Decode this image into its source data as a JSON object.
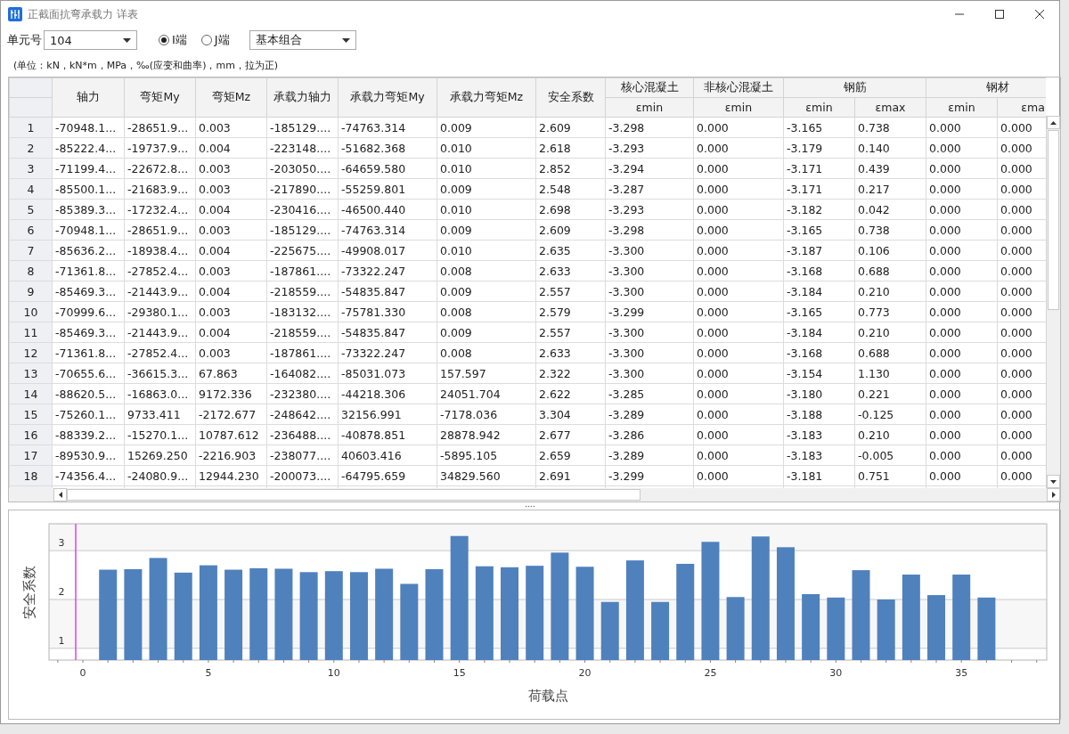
{
  "window": {
    "title": "正截面抗弯承载力 详表"
  },
  "toolbar": {
    "unit_label": "单元号",
    "unit_value": "104",
    "end_options": [
      {
        "label": "I端",
        "selected": true
      },
      {
        "label": "J端",
        "selected": false
      }
    ],
    "combo_value": "基本组合"
  },
  "note": "(单位：kN，kN*m，MPa，‰(应变和曲率)，mm，拉为正)",
  "table": {
    "columns": [
      {
        "label": "轴力"
      },
      {
        "label": "弯矩My"
      },
      {
        "label": "弯矩Mz"
      },
      {
        "label": "承载力轴力"
      },
      {
        "label": "承载力弯矩My"
      },
      {
        "label": "承载力弯矩Mz"
      },
      {
        "label": "安全系数"
      },
      {
        "label": "核心混凝土",
        "sub": [
          "εmin"
        ]
      },
      {
        "label": "非核心混凝土",
        "sub": [
          "εmin"
        ]
      },
      {
        "label": "钢筋",
        "colspan": 2,
        "sub": [
          "εmin",
          "εmax"
        ]
      },
      {
        "label": "钢材",
        "colspan": 2,
        "sub": [
          "εmin",
          "εma"
        ]
      }
    ],
    "rows": [
      {
        "index": "1",
        "cells": [
          "-70948.1...",
          "-28651.9...",
          "0.003",
          "-185129....",
          "-74763.314",
          "0.009",
          "2.609",
          "-3.298",
          "0.000",
          "-3.165",
          "0.738",
          "0.000",
          "0.000"
        ]
      },
      {
        "index": "2",
        "cells": [
          "-85222.4...",
          "-19737.9...",
          "0.004",
          "-223148....",
          "-51682.368",
          "0.010",
          "2.618",
          "-3.293",
          "0.000",
          "-3.179",
          "0.140",
          "0.000",
          "0.000"
        ]
      },
      {
        "index": "3",
        "cells": [
          "-71199.4...",
          "-22672.8...",
          "0.003",
          "-203050....",
          "-64659.580",
          "0.010",
          "2.852",
          "-3.294",
          "0.000",
          "-3.171",
          "0.439",
          "0.000",
          "0.000"
        ]
      },
      {
        "index": "4",
        "cells": [
          "-85500.1...",
          "-21683.9...",
          "0.003",
          "-217890....",
          "-55259.801",
          "0.009",
          "2.548",
          "-3.287",
          "0.000",
          "-3.171",
          "0.217",
          "0.000",
          "0.000"
        ]
      },
      {
        "index": "5",
        "cells": [
          "-85389.3...",
          "-17232.4...",
          "0.004",
          "-230416....",
          "-46500.440",
          "0.010",
          "2.698",
          "-3.293",
          "0.000",
          "-3.182",
          "0.042",
          "0.000",
          "0.000"
        ]
      },
      {
        "index": "6",
        "cells": [
          "-70948.1...",
          "-28651.9...",
          "0.003",
          "-185129....",
          "-74763.314",
          "0.009",
          "2.609",
          "-3.298",
          "0.000",
          "-3.165",
          "0.738",
          "0.000",
          "0.000"
        ]
      },
      {
        "index": "7",
        "cells": [
          "-85636.2...",
          "-18938.4...",
          "0.004",
          "-225675....",
          "-49908.017",
          "0.010",
          "2.635",
          "-3.300",
          "0.000",
          "-3.187",
          "0.106",
          "0.000",
          "0.000"
        ]
      },
      {
        "index": "8",
        "cells": [
          "-71361.8...",
          "-27852.4...",
          "0.003",
          "-187861....",
          "-73322.247",
          "0.008",
          "2.633",
          "-3.300",
          "0.000",
          "-3.168",
          "0.688",
          "0.000",
          "0.000"
        ]
      },
      {
        "index": "9",
        "cells": [
          "-85469.3...",
          "-21443.9...",
          "0.004",
          "-218559....",
          "-54835.847",
          "0.009",
          "2.557",
          "-3.300",
          "0.000",
          "-3.184",
          "0.210",
          "0.000",
          "0.000"
        ]
      },
      {
        "index": "10",
        "cells": [
          "-70999.6...",
          "-29380.1...",
          "0.003",
          "-183132....",
          "-75781.330",
          "0.008",
          "2.579",
          "-3.299",
          "0.000",
          "-3.165",
          "0.773",
          "0.000",
          "0.000"
        ]
      },
      {
        "index": "11",
        "cells": [
          "-85469.3...",
          "-21443.9...",
          "0.004",
          "-218559....",
          "-54835.847",
          "0.009",
          "2.557",
          "-3.300",
          "0.000",
          "-3.184",
          "0.210",
          "0.000",
          "0.000"
        ]
      },
      {
        "index": "12",
        "cells": [
          "-71361.8...",
          "-27852.4...",
          "0.003",
          "-187861....",
          "-73322.247",
          "0.008",
          "2.633",
          "-3.300",
          "0.000",
          "-3.168",
          "0.688",
          "0.000",
          "0.000"
        ]
      },
      {
        "index": "13",
        "cells": [
          "-70655.6...",
          "-36615.3...",
          "67.863",
          "-164082....",
          "-85031.073",
          "157.597",
          "2.322",
          "-3.300",
          "0.000",
          "-3.154",
          "1.130",
          "0.000",
          "0.000"
        ]
      },
      {
        "index": "14",
        "cells": [
          "-88620.5...",
          "-16863.0...",
          "9172.336",
          "-232380....",
          "-44218.306",
          "24051.704",
          "2.622",
          "-3.285",
          "0.000",
          "-3.180",
          "0.221",
          "0.000",
          "0.000"
        ]
      },
      {
        "index": "15",
        "cells": [
          "-75260.1...",
          "9733.411",
          "-2172.677",
          "-248642....",
          "32156.991",
          "-7178.036",
          "3.304",
          "-3.289",
          "0.000",
          "-3.188",
          "-0.125",
          "0.000",
          "0.000"
        ]
      },
      {
        "index": "16",
        "cells": [
          "-88339.2...",
          "-15270.1...",
          "10787.612",
          "-236488....",
          "-40878.851",
          "28878.942",
          "2.677",
          "-3.286",
          "0.000",
          "-3.183",
          "0.210",
          "0.000",
          "0.000"
        ]
      },
      {
        "index": "17",
        "cells": [
          "-89530.9...",
          "15269.250",
          "-2216.903",
          "-238077....",
          "40603.416",
          "-5895.105",
          "2.659",
          "-3.289",
          "0.000",
          "-3.183",
          "-0.005",
          "0.000",
          "0.000"
        ]
      },
      {
        "index": "18",
        "cells": [
          "-74356.4...",
          "-24080.9...",
          "12944.230",
          "-200073....",
          "-64795.659",
          "34829.560",
          "2.691",
          "-3.299",
          "0.000",
          "-3.181",
          "0.751",
          "0.000",
          "0.000"
        ]
      }
    ]
  },
  "chart": {
    "chart_data": {
      "type": "bar",
      "xlabel": "荷载点",
      "ylabel": "安全系数",
      "x": [
        1,
        2,
        3,
        4,
        5,
        6,
        7,
        8,
        9,
        10,
        11,
        12,
        13,
        14,
        15,
        16,
        17,
        18,
        19,
        20,
        21,
        22,
        23,
        24,
        25,
        26,
        27,
        28,
        29,
        30,
        31,
        32,
        33,
        34,
        35,
        36
      ],
      "values": [
        2.61,
        2.62,
        2.85,
        2.55,
        2.7,
        2.61,
        2.64,
        2.63,
        2.56,
        2.58,
        2.56,
        2.63,
        2.32,
        2.62,
        3.3,
        2.68,
        2.66,
        2.69,
        2.96,
        2.67,
        1.95,
        2.8,
        1.95,
        2.73,
        3.18,
        2.05,
        3.29,
        3.07,
        2.11,
        2.04,
        2.6,
        2.0,
        2.51,
        2.09,
        2.51,
        2.04
      ],
      "xlim": [
        -1.35,
        38.4
      ],
      "ylim": [
        0.76,
        3.55
      ],
      "xticks": [
        0,
        5,
        10,
        15,
        20,
        25,
        30,
        35
      ],
      "yticks": [
        1,
        2,
        3
      ],
      "grid": true
    }
  }
}
